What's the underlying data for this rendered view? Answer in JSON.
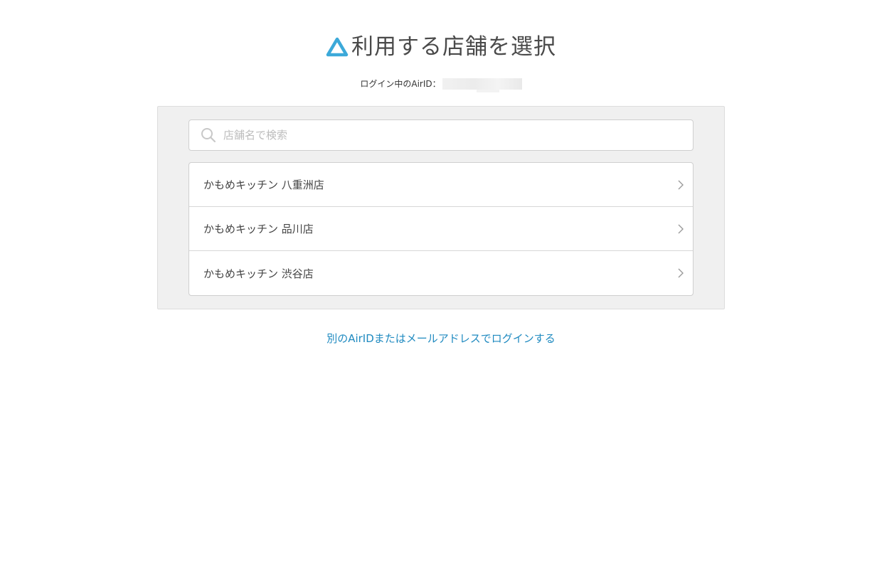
{
  "header": {
    "title": "利用する店舗を選択",
    "logo_icon": "airid-triangle-icon",
    "logo_color": "#3ca9d9"
  },
  "login_info": {
    "label": "ログイン中のAirID："
  },
  "search": {
    "placeholder": "店舗名で検索",
    "icon": "search-icon"
  },
  "stores": [
    {
      "name": "かもめキッチン 八重洲店"
    },
    {
      "name": "かもめキッチン 品川店"
    },
    {
      "name": "かもめキッチン 渋谷店"
    }
  ],
  "alt_login": {
    "label": "別のAirIDまたはメールアドレスでログインする",
    "color": "#1f8ac0"
  }
}
